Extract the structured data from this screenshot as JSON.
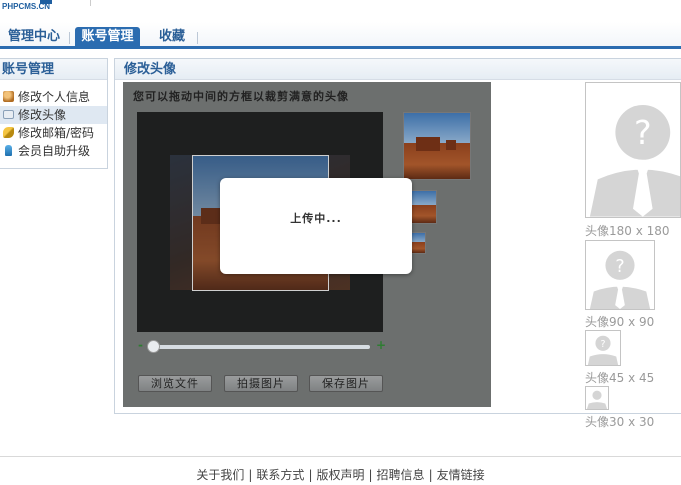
{
  "brand": {
    "logo_text": "PHPCMS.CN"
  },
  "nav": {
    "tabs": [
      {
        "label": "管理中心"
      },
      {
        "label": "账号管理"
      },
      {
        "label": "收藏"
      }
    ]
  },
  "sidebar": {
    "title": "账号管理",
    "items": [
      {
        "label": "修改个人信息",
        "icon": "user-edit-icon"
      },
      {
        "label": "修改头像",
        "icon": "id-card-icon"
      },
      {
        "label": "修改邮箱/密码",
        "icon": "key-icon"
      },
      {
        "label": "会员自助升级",
        "icon": "upgrade-icon"
      }
    ]
  },
  "main": {
    "title": "修改头像",
    "hint": "您可以拖动中间的方框以裁剪满意的头像",
    "zoom": {
      "minus": "-",
      "plus": "+"
    },
    "buttons": {
      "browse": "浏览文件",
      "capture": "拍摄图片",
      "save": "保存图片"
    },
    "modal_text": "上传中..."
  },
  "avatars": [
    {
      "label": "头像180 x 180"
    },
    {
      "label": "头像90 x 90"
    },
    {
      "label": "头像45 x 45"
    },
    {
      "label": "头像30 x 30"
    }
  ],
  "footer": {
    "links": [
      "关于我们",
      "联系方式",
      "版权声明",
      "招聘信息",
      "友情链接"
    ],
    "separator": "|"
  },
  "colors": {
    "accent": "#2b6cb0",
    "title": "#2b5f97",
    "editor_bg": "#6c6f6e"
  }
}
